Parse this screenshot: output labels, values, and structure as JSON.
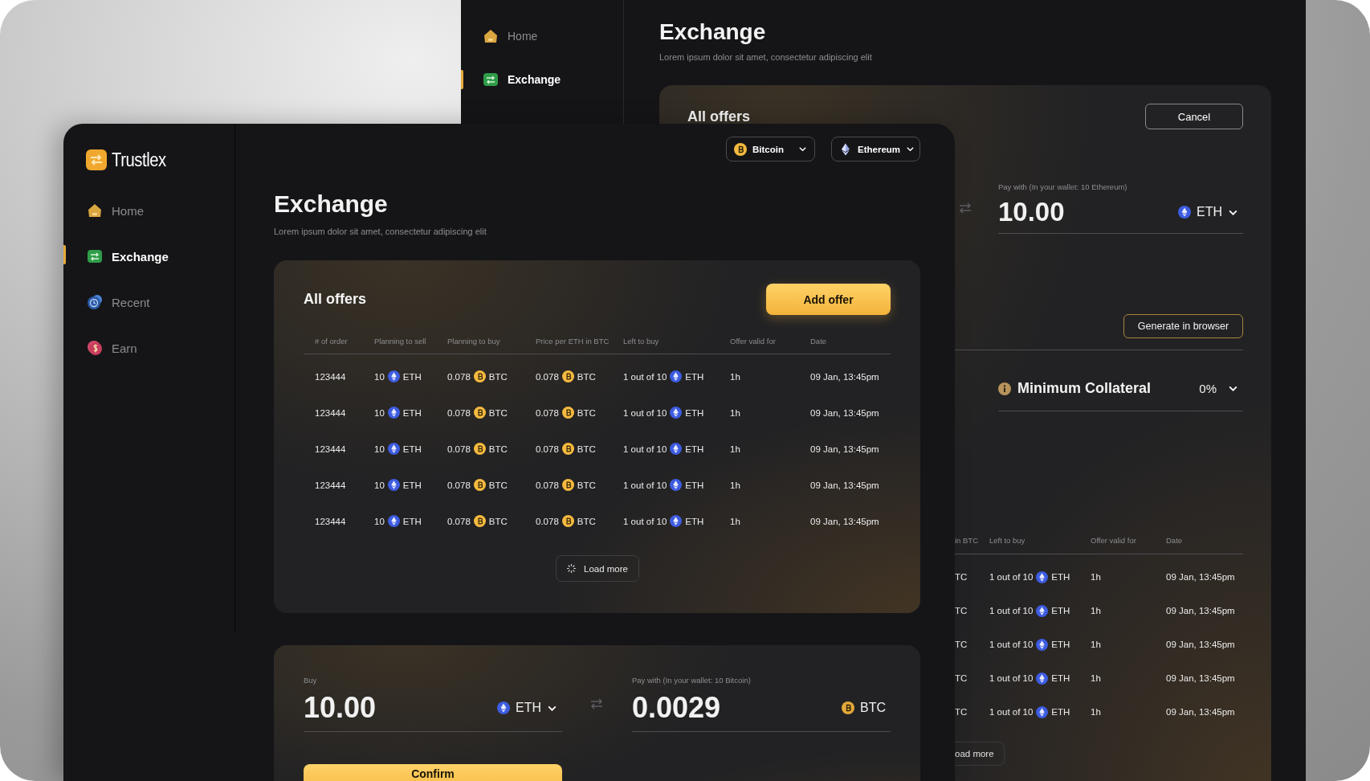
{
  "back_window": {
    "sidebar": {
      "items": [
        {
          "label": "Home",
          "kind": "home",
          "selected": false
        },
        {
          "label": "Exchange",
          "kind": "exchange",
          "selected": true
        }
      ]
    },
    "title": "Exchange",
    "subtitle": "Lorem ipsum dolor sit amet, consectetur adipiscing elit",
    "card": {
      "title": "All offers",
      "cancel_button": "Cancel",
      "pay_field": {
        "label": "Pay with (In your wallet: 10 Ethereum)",
        "value": "10.00",
        "unit": "ETH",
        "kind": "eth",
        "dropdown": true
      },
      "generate_button": "Generate in browser",
      "collateral": {
        "label": "Minimum Collateral",
        "value": "0%"
      },
      "table": {
        "columns": [
          "in BTC",
          "Left to buy",
          "Offer valid for",
          "Date"
        ],
        "rows": [
          {
            "cells": [
              {
                "kind": "text",
                "text": "TC"
              },
              {
                "kind": "eth",
                "amount": "1 out of 10",
                "unit": "ETH"
              },
              {
                "kind": "text",
                "text": "1h"
              },
              {
                "kind": "text",
                "text": "09 Jan, 13:45pm"
              }
            ]
          },
          {
            "cells": [
              {
                "kind": "text",
                "text": "TC"
              },
              {
                "kind": "eth",
                "amount": "1 out of 10",
                "unit": "ETH"
              },
              {
                "kind": "text",
                "text": "1h"
              },
              {
                "kind": "text",
                "text": "09 Jan, 13:45pm"
              }
            ]
          },
          {
            "cells": [
              {
                "kind": "text",
                "text": "TC"
              },
              {
                "kind": "eth",
                "amount": "1 out of 10",
                "unit": "ETH"
              },
              {
                "kind": "text",
                "text": "1h"
              },
              {
                "kind": "text",
                "text": "09 Jan, 13:45pm"
              }
            ]
          },
          {
            "cells": [
              {
                "kind": "text",
                "text": "TC"
              },
              {
                "kind": "eth",
                "amount": "1 out of 10",
                "unit": "ETH"
              },
              {
                "kind": "text",
                "text": "1h"
              },
              {
                "kind": "text",
                "text": "09 Jan, 13:45pm"
              }
            ]
          },
          {
            "cells": [
              {
                "kind": "text",
                "text": "TC"
              },
              {
                "kind": "eth",
                "amount": "1 out of 10",
                "unit": "ETH"
              },
              {
                "kind": "text",
                "text": "1h"
              },
              {
                "kind": "text",
                "text": "09 Jan, 13:45pm"
              }
            ]
          }
        ]
      },
      "load_more": "oad more"
    }
  },
  "front_window": {
    "logo": "Trustlex",
    "sidebar": {
      "items": [
        {
          "label": "Home",
          "kind": "home",
          "selected": false
        },
        {
          "label": "Exchange",
          "kind": "exchange",
          "selected": true
        },
        {
          "label": "Recent",
          "kind": "recent",
          "selected": false
        },
        {
          "label": "Earn",
          "kind": "earn",
          "selected": false
        }
      ]
    },
    "currency_selects": [
      {
        "label": "Bitcoin",
        "kind": "btc"
      },
      {
        "label": "Ethereum",
        "kind": "eth"
      }
    ],
    "title": "Exchange",
    "subtitle": "Lorem ipsum dolor sit amet, consectetur adipiscing elit",
    "offers_card": {
      "title": "All offers",
      "add_button": "Add offer",
      "table": {
        "columns": [
          "# of order",
          "Planning to sell",
          "Planning to buy",
          "Price per ETH in BTC",
          "Left to buy",
          "Offer valid for",
          "Date"
        ],
        "rows": [
          {
            "cells": [
              {
                "kind": "text",
                "text": "123444"
              },
              {
                "kind": "eth",
                "amount": "10",
                "unit": "ETH"
              },
              {
                "kind": "btc",
                "amount": "0.078",
                "unit": "BTC"
              },
              {
                "kind": "btc",
                "amount": "0.078",
                "unit": "BTC"
              },
              {
                "kind": "eth",
                "amount": "1 out of 10",
                "unit": "ETH"
              },
              {
                "kind": "text",
                "text": "1h"
              },
              {
                "kind": "text",
                "text": "09 Jan, 13:45pm"
              }
            ]
          },
          {
            "cells": [
              {
                "kind": "text",
                "text": "123444"
              },
              {
                "kind": "eth",
                "amount": "10",
                "unit": "ETH"
              },
              {
                "kind": "btc",
                "amount": "0.078",
                "unit": "BTC"
              },
              {
                "kind": "btc",
                "amount": "0.078",
                "unit": "BTC"
              },
              {
                "kind": "eth",
                "amount": "1 out of 10",
                "unit": "ETH"
              },
              {
                "kind": "text",
                "text": "1h"
              },
              {
                "kind": "text",
                "text": "09 Jan, 13:45pm"
              }
            ]
          },
          {
            "cells": [
              {
                "kind": "text",
                "text": "123444"
              },
              {
                "kind": "eth",
                "amount": "10",
                "unit": "ETH"
              },
              {
                "kind": "btc",
                "amount": "0.078",
                "unit": "BTC"
              },
              {
                "kind": "btc",
                "amount": "0.078",
                "unit": "BTC"
              },
              {
                "kind": "eth",
                "amount": "1 out of 10",
                "unit": "ETH"
              },
              {
                "kind": "text",
                "text": "1h"
              },
              {
                "kind": "text",
                "text": "09 Jan, 13:45pm"
              }
            ]
          },
          {
            "cells": [
              {
                "kind": "text",
                "text": "123444"
              },
              {
                "kind": "eth",
                "amount": "10",
                "unit": "ETH"
              },
              {
                "kind": "btc",
                "amount": "0.078",
                "unit": "BTC"
              },
              {
                "kind": "btc",
                "amount": "0.078",
                "unit": "BTC"
              },
              {
                "kind": "eth",
                "amount": "1 out of 10",
                "unit": "ETH"
              },
              {
                "kind": "text",
                "text": "1h"
              },
              {
                "kind": "text",
                "text": "09 Jan, 13:45pm"
              }
            ]
          },
          {
            "cells": [
              {
                "kind": "text",
                "text": "123444"
              },
              {
                "kind": "eth",
                "amount": "10",
                "unit": "ETH"
              },
              {
                "kind": "btc",
                "amount": "0.078",
                "unit": "BTC"
              },
              {
                "kind": "btc",
                "amount": "0.078",
                "unit": "BTC"
              },
              {
                "kind": "eth",
                "amount": "1 out of 10",
                "unit": "ETH"
              },
              {
                "kind": "text",
                "text": "1h"
              },
              {
                "kind": "text",
                "text": "09 Jan, 13:45pm"
              }
            ]
          }
        ]
      },
      "load_more": "Load more"
    },
    "trade_card": {
      "buy_field": {
        "label": "Buy",
        "value": "10.00",
        "unit": "ETH",
        "kind": "eth",
        "dropdown": true
      },
      "pay_field": {
        "label": "Pay with (In your wallet: 10 Bitcoin)",
        "value": "0.0029",
        "unit": "BTC",
        "kind": "btc",
        "dropdown": false
      },
      "confirm_button": "Confirm"
    }
  }
}
